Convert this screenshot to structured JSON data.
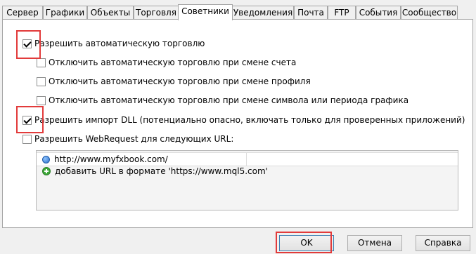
{
  "tabs": [
    {
      "label": "Сервер"
    },
    {
      "label": "Графики"
    },
    {
      "label": "Объекты"
    },
    {
      "label": "Торговля"
    },
    {
      "label": "Советники"
    },
    {
      "label": "Уведомления"
    },
    {
      "label": "Почта"
    },
    {
      "label": "FTP"
    },
    {
      "label": "События"
    },
    {
      "label": "Сообщество"
    }
  ],
  "active_tab": "Советники",
  "options": {
    "allow_auto_trading": {
      "label": "Разрешить автоматическую торговлю",
      "checked": true
    },
    "disable_on_account_change": {
      "label": "Отключить автоматическую торговлю при смене счета",
      "checked": false
    },
    "disable_on_profile_change": {
      "label": "Отключить автоматическую торговлю при смене профиля",
      "checked": false
    },
    "disable_on_symbol_change": {
      "label": "Отключить автоматическую торговлю при смене символа или периода графика",
      "checked": false
    },
    "allow_dll_import": {
      "label": "Разрешить импорт DLL (потенциально опасно, включать только для проверенных приложений)",
      "checked": true
    },
    "allow_webrequest": {
      "label": "Разрешить WebRequest для следующих URL:",
      "checked": false
    }
  },
  "url_list": {
    "items": [
      {
        "url": "http://www.myfxbook.com/",
        "icon": "globe-icon"
      }
    ],
    "add_hint": "добавить URL в формате 'https://www.mql5.com'",
    "add_icon": "plus-icon"
  },
  "buttons": {
    "ok": "OK",
    "cancel": "Отмена",
    "help": "Справка"
  },
  "colors": {
    "highlight": "#e23b3b",
    "panel_bg": "#ffffff",
    "window_bg": "#f0f0f0"
  }
}
